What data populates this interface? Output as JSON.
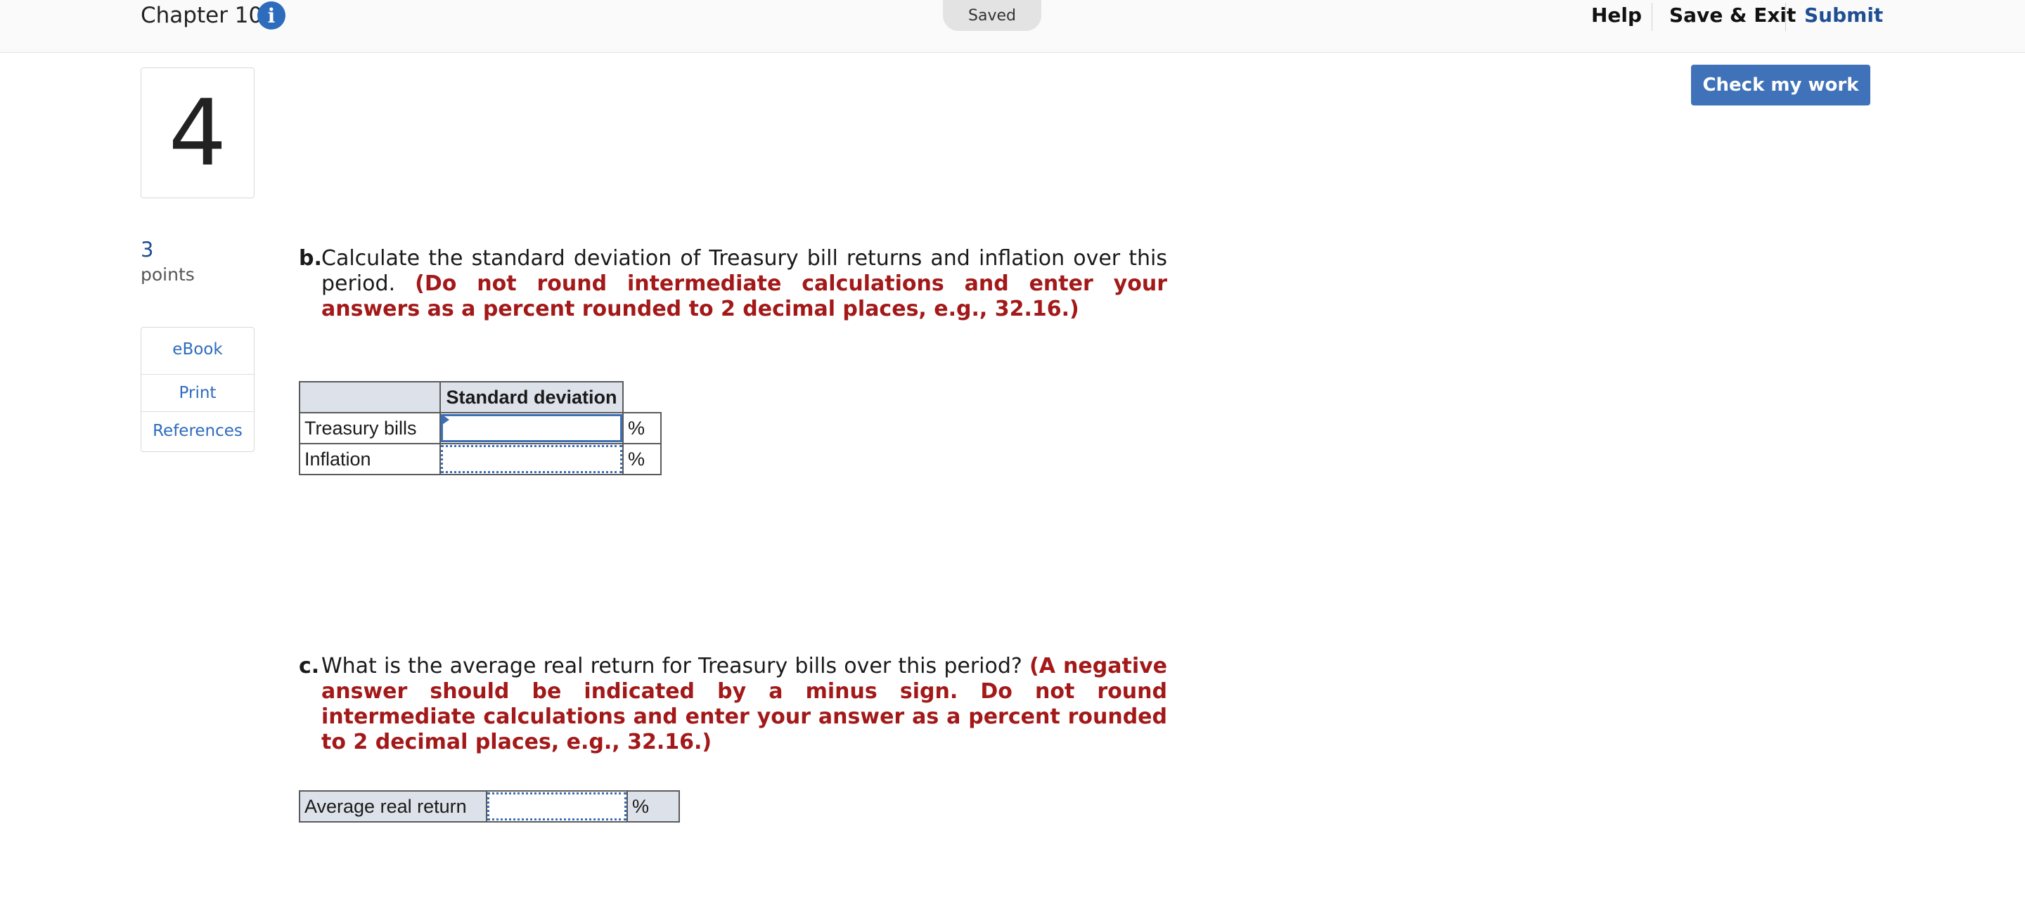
{
  "header": {
    "chapter_title": "Chapter 10",
    "info_icon": "i",
    "status": "Saved",
    "help_label": "Help",
    "save_exit_label": "Save & Exit",
    "submit_label": "Submit"
  },
  "actions": {
    "check_work_label": "Check my work"
  },
  "question": {
    "number": "4",
    "points_value": "3",
    "points_label": "points"
  },
  "tools": {
    "ebook": "eBook",
    "print": "Print",
    "references": "References"
  },
  "part_b": {
    "letter": "b.",
    "text": "Calculate the standard deviation of Treasury bill returns and inflation over this period.",
    "hint": "(Do not round intermediate calculations and enter your answers as a percent rounded to 2 decimal places, e.g., 32.16.)",
    "table": {
      "column_header": "Standard deviation",
      "rows": [
        {
          "label": "Treasury bills",
          "value": "",
          "unit": "%"
        },
        {
          "label": "Inflation",
          "value": "",
          "unit": "%"
        }
      ]
    }
  },
  "part_c": {
    "letter": "c.",
    "text": "What is the average real return for Treasury bills over this period?",
    "hint": "(A negative answer should be indicated by a minus sign. Do not round intermediate calculations and enter your answer as a percent rounded to 2 decimal places, e.g., 32.16.)",
    "table": {
      "label": "Average real return",
      "value": "",
      "unit": "%"
    }
  },
  "colors": {
    "accent": "#3f72b8",
    "hint_red": "#a31919",
    "link_blue": "#2d6bbd"
  }
}
